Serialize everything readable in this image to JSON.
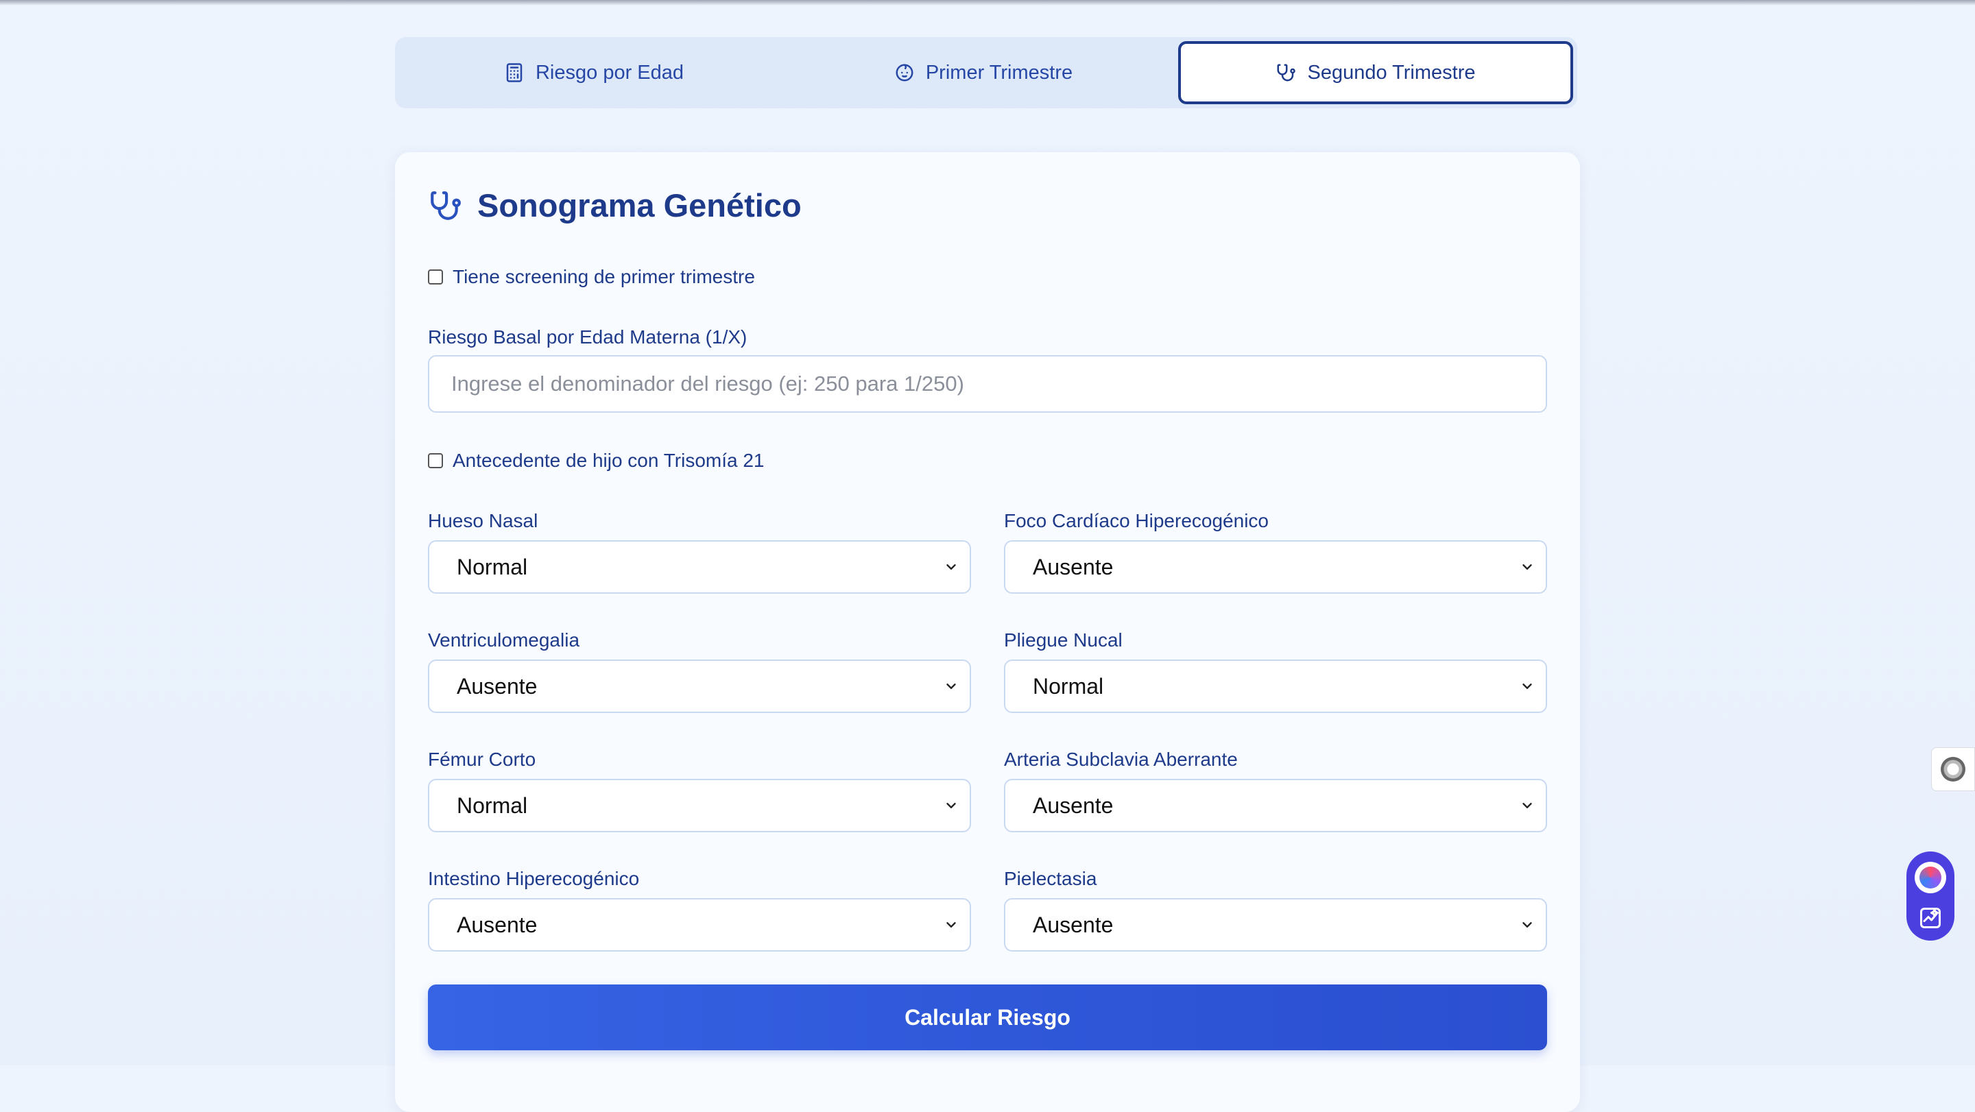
{
  "tabs": [
    {
      "label": "Riesgo por Edad",
      "icon": "calculator-icon",
      "active": false
    },
    {
      "label": "Primer Trimestre",
      "icon": "baby-face-icon",
      "active": false
    },
    {
      "label": "Segundo Trimestre",
      "icon": "stethoscope-icon",
      "active": true
    }
  ],
  "card": {
    "title": "Sonograma Genético",
    "title_icon": "stethoscope-icon",
    "first_trimester_checkbox": "Tiene screening de primer trimestre",
    "basal_risk_label": "Riesgo Basal por Edad Materna (1/X)",
    "basal_risk_placeholder": "Ingrese el denominador del riesgo (ej: 250 para 1/250)",
    "basal_risk_value": "",
    "trisomy_checkbox": "Antecedente de hijo con Trisomía 21",
    "fields": [
      {
        "label": "Hueso Nasal",
        "value": "Normal"
      },
      {
        "label": "Foco Cardíaco Hiperecogénico",
        "value": "Ausente"
      },
      {
        "label": "Ventriculomegalia",
        "value": "Ausente"
      },
      {
        "label": "Pliegue Nucal",
        "value": "Normal"
      },
      {
        "label": "Fémur Corto",
        "value": "Normal"
      },
      {
        "label": "Arteria Subclavia Aberrante",
        "value": "Ausente"
      },
      {
        "label": "Intestino Hiperecogénico",
        "value": "Ausente"
      },
      {
        "label": "Pielectasia",
        "value": "Ausente"
      }
    ],
    "submit_label": "Calcular Riesgo"
  },
  "colors": {
    "primary": "#2f58d9",
    "text": "#1e3a8a",
    "background": "#eef4fd",
    "tab_bar": "#dde8f8"
  }
}
